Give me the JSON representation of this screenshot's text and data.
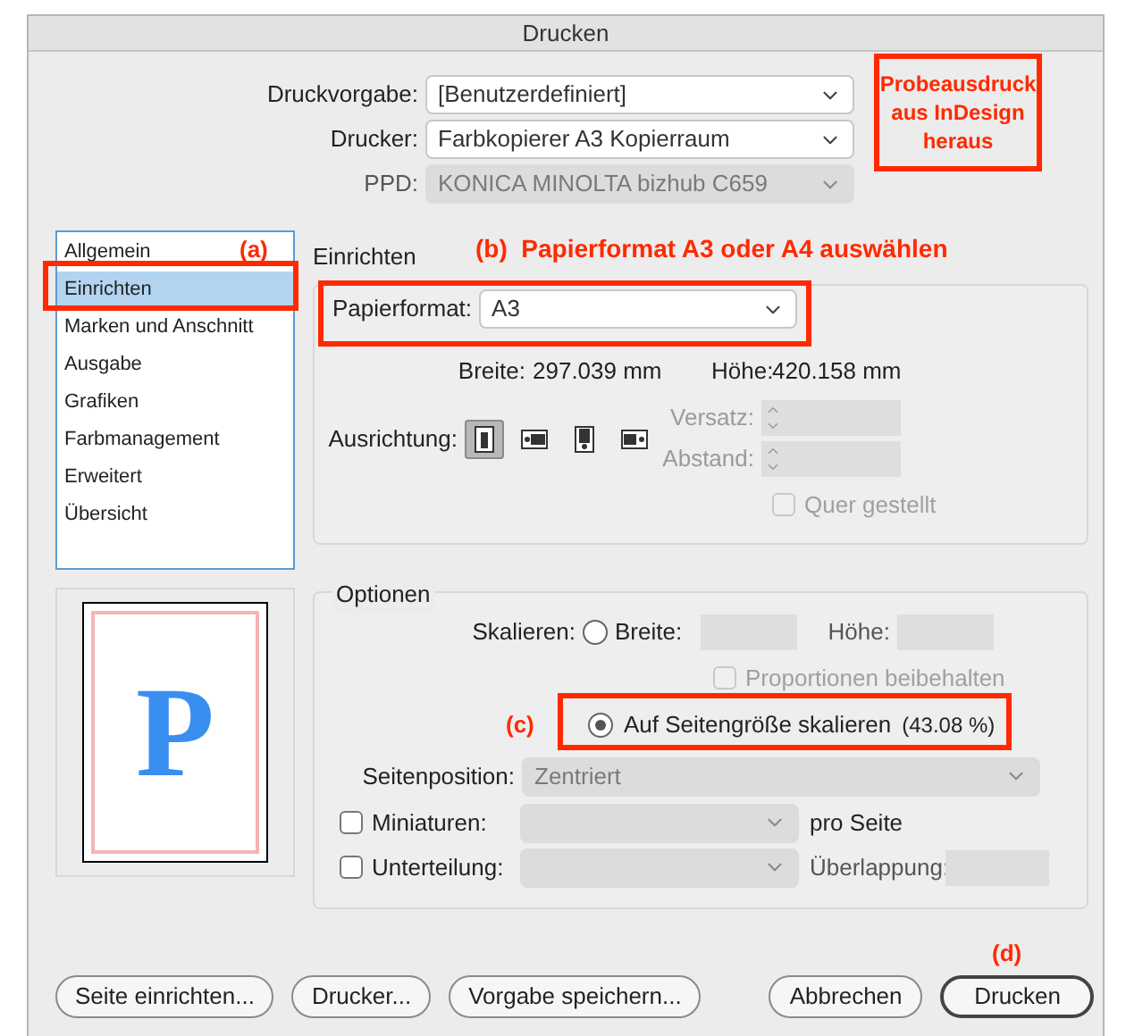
{
  "window": {
    "title": "Drucken"
  },
  "presets": [
    {
      "label": "Druckvorgabe:",
      "value": "[Benutzerdefiniert]",
      "disabled": false
    },
    {
      "label": "Drucker:",
      "value": "Farbkopierer A3 Kopierraum",
      "disabled": false
    },
    {
      "label": "PPD:",
      "value": "KONICA MINOLTA bizhub C659",
      "disabled": true
    }
  ],
  "sidebar": {
    "items": [
      {
        "label": "Allgemein",
        "selected": false
      },
      {
        "label": "Einrichten",
        "selected": true
      },
      {
        "label": "Marken und Anschnitt",
        "selected": false
      },
      {
        "label": "Ausgabe",
        "selected": false
      },
      {
        "label": "Grafiken",
        "selected": false
      },
      {
        "label": "Farbmanagement",
        "selected": false
      },
      {
        "label": "Erweitert",
        "selected": false
      },
      {
        "label": "Übersicht",
        "selected": false
      }
    ]
  },
  "preview": {
    "letter": "P"
  },
  "setup": {
    "title": "Einrichten",
    "paper_format": {
      "label": "Papierformat:",
      "value": "A3"
    },
    "width": {
      "label": "Breite:",
      "value": "297.039 mm"
    },
    "height": {
      "label": "Höhe:",
      "value": "420.158 mm"
    },
    "orientation": {
      "label": "Ausrichtung:",
      "options": [
        {
          "kind": "portrait",
          "selected": true
        },
        {
          "kind": "landscape",
          "selected": false
        },
        {
          "kind": "reverse-portrait",
          "selected": false
        },
        {
          "kind": "reverse-landscape",
          "selected": false
        }
      ]
    },
    "offset": {
      "label": "Versatz:",
      "disabled": true
    },
    "gap": {
      "label": "Abstand:",
      "disabled": true
    },
    "transverse": {
      "label": "Quer gestellt",
      "checked": false,
      "disabled": true
    }
  },
  "options": {
    "title": "Optionen",
    "scale_label": "Skalieren:",
    "scale_width": {
      "label": "Breite:",
      "selected": false
    },
    "scale_height_label": "Höhe:",
    "proportions": {
      "label": "Proportionen beibehalten",
      "checked": false,
      "disabled": true
    },
    "fit": {
      "label": "Auf Seitengröße skalieren",
      "reading": "(43.08 %)",
      "selected": true
    },
    "page_position": {
      "label": "Seitenposition:",
      "value": "Zentriert"
    },
    "thumbnails": {
      "label": "Miniaturen:",
      "checked": false,
      "suffix": "pro Seite"
    },
    "tiling": {
      "label": "Unterteilung:",
      "checked": false,
      "overlap_label": "Überlappung:"
    }
  },
  "buttons": [
    {
      "label": "Seite einrichten...",
      "default": false
    },
    {
      "label": "Drucker...",
      "default": false
    },
    {
      "label": "Vorgabe speichern...",
      "default": false
    },
    {
      "label": "Abbrechen",
      "default": false
    },
    {
      "label": "Drucken",
      "default": true
    }
  ],
  "annotations": [
    {
      "text": "Probeausdruck\naus InDesign\nheraus"
    },
    {
      "text": "(a)"
    },
    {
      "text": "(b)  Papierformat A3 oder A4 auswählen"
    },
    {
      "text": "(c)"
    },
    {
      "text": "(d)"
    }
  ]
}
